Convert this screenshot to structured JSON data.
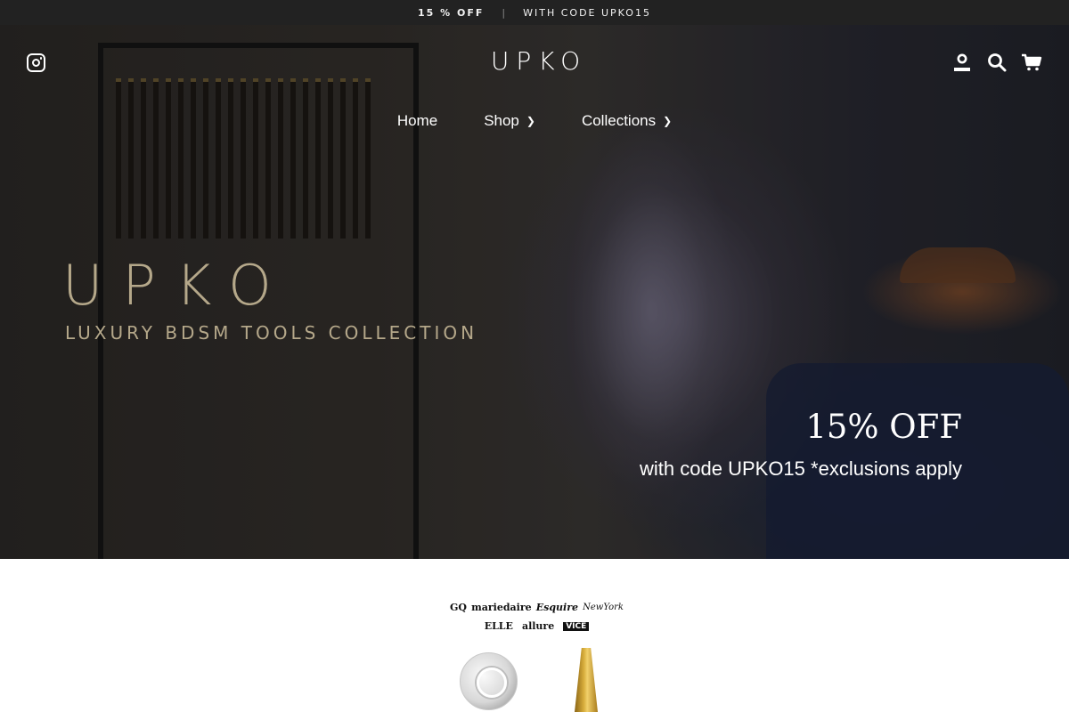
{
  "announcement": {
    "bold": "15 % OFF",
    "separator": "|",
    "text": "WITH CODE UPKO15"
  },
  "header": {
    "logo": "UPKO",
    "icons": {
      "social": "instagram-icon",
      "account": "account-icon",
      "search": "search-icon",
      "cart": "cart-icon"
    }
  },
  "nav": {
    "items": [
      {
        "label": "Home",
        "has_submenu": false
      },
      {
        "label": "Shop",
        "has_submenu": true
      },
      {
        "label": "Collections",
        "has_submenu": true
      }
    ]
  },
  "hero": {
    "brand_title": "UPKO",
    "brand_subtitle": "LUXURY BDSM TOOLS COLLECTION",
    "headline": "15% OFF",
    "subline": "with code UPKO15 *exclusions apply"
  },
  "press": {
    "row1": [
      "GQ",
      "mariedaire",
      "Esquire",
      "NewYork"
    ],
    "row2": [
      "ELLE",
      "allure",
      "VICE"
    ]
  },
  "colors": {
    "announcement_bg": "#222222",
    "brand_gold": "#b5a88a",
    "text_white": "#ffffff"
  }
}
